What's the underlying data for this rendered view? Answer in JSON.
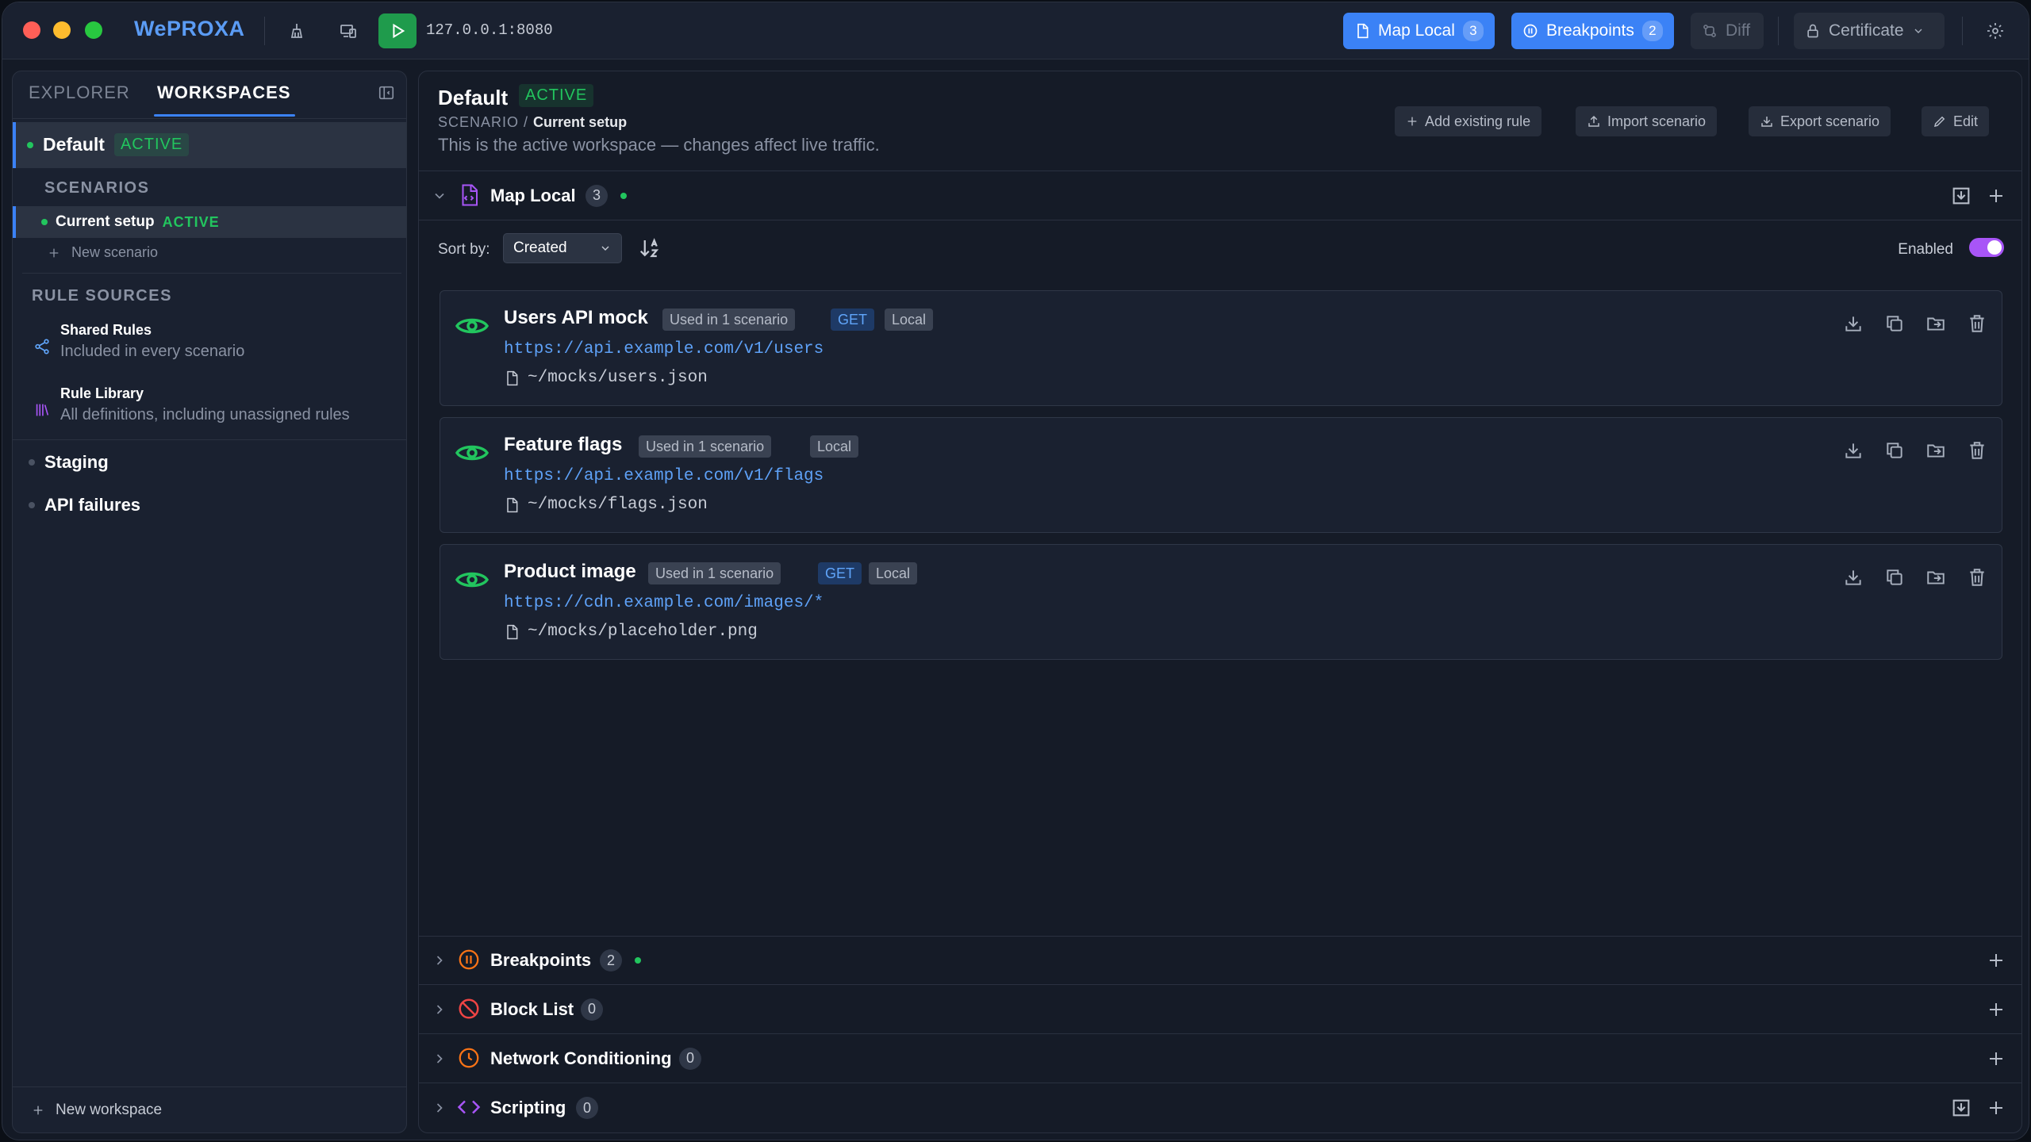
{
  "titlebar": {
    "brand": "WePROXA",
    "address": "127.0.0.1:8080",
    "map_local": {
      "label": "Map Local",
      "count": "3"
    },
    "breakpoints": {
      "label": "Breakpoints",
      "count": "2"
    },
    "diff": {
      "label": "Diff"
    },
    "certificate": {
      "label": "Certificate"
    }
  },
  "sidebar": {
    "tabs": [
      {
        "label": "EXPLORER"
      },
      {
        "label": "WORKSPACES"
      }
    ],
    "active_workspace": {
      "name": "Default",
      "badge": "ACTIVE"
    },
    "scenarios_label": "SCENARIOS",
    "scenarios": [
      {
        "name": "Current setup",
        "badge": "ACTIVE"
      }
    ],
    "new_scenario": "New scenario",
    "rule_sources_label": "RULE SOURCES",
    "rule_sources": [
      {
        "title": "Shared Rules",
        "subtitle": "Included in every scenario"
      },
      {
        "title": "Rule Library",
        "subtitle": "All definitions, including unassigned rules"
      }
    ],
    "workspaces": [
      {
        "name": "Staging"
      },
      {
        "name": "API failures"
      }
    ],
    "new_workspace": "New workspace"
  },
  "main": {
    "title": "Default",
    "badge": "ACTIVE",
    "crumb_label": "SCENARIO",
    "crumb_sep": "/",
    "crumb_value": "Current setup",
    "description": "This is the active workspace — changes affect live traffic.",
    "buttons": {
      "add_rule": "Add existing rule",
      "import": "Import scenario",
      "export": "Export scenario",
      "edit": "Edit"
    },
    "sort_label": "Sort by:",
    "sort_value": "Created",
    "enabled_label": "Enabled",
    "sections": [
      {
        "title": "Map Local",
        "count": "3"
      },
      {
        "title": "Breakpoints",
        "count": "2"
      },
      {
        "title": "Block List",
        "count": "0"
      },
      {
        "title": "Network Conditioning",
        "count": "0"
      },
      {
        "title": "Scripting",
        "count": "0"
      }
    ],
    "rules": [
      {
        "name": "Users API mock",
        "used": "Used in 1 scenario",
        "method": "GET",
        "scope": "Local",
        "url": "https://api.example.com/v1/users",
        "file": "~/mocks/users.json"
      },
      {
        "name": "Feature flags",
        "used": "Used in 1 scenario",
        "method": "",
        "scope": "Local",
        "url": "https://api.example.com/v1/flags",
        "file": "~/mocks/flags.json"
      },
      {
        "name": "Product image",
        "used": "Used in 1 scenario",
        "method": "GET",
        "scope": "Local",
        "url": "https://cdn.example.com/images/*",
        "file": "~/mocks/placeholder.png"
      }
    ]
  },
  "colors": {
    "accent": "#3b82f6",
    "active_green": "#22c55e",
    "toggle_purple": "#a855f7",
    "link_blue": "#5ea1f7"
  },
  "icons": [
    "traffic-light-close",
    "traffic-light-minimize",
    "traffic-light-zoom",
    "broom-icon",
    "devices-icon",
    "play-icon",
    "map-local-icon",
    "breakpoint-icon",
    "diff-icon",
    "lock-icon",
    "chevron-down-icon",
    "gear-icon",
    "sidebar-collapse-icon",
    "plus-icon",
    "share-icon",
    "library-icon",
    "eye-icon",
    "download-icon",
    "copy-icon",
    "move-icon",
    "trash-icon",
    "file-icon",
    "sort-alpha-icon",
    "block-icon",
    "clock-icon",
    "code-icon",
    "import-icon",
    "upload-icon",
    "pencil-icon"
  ]
}
